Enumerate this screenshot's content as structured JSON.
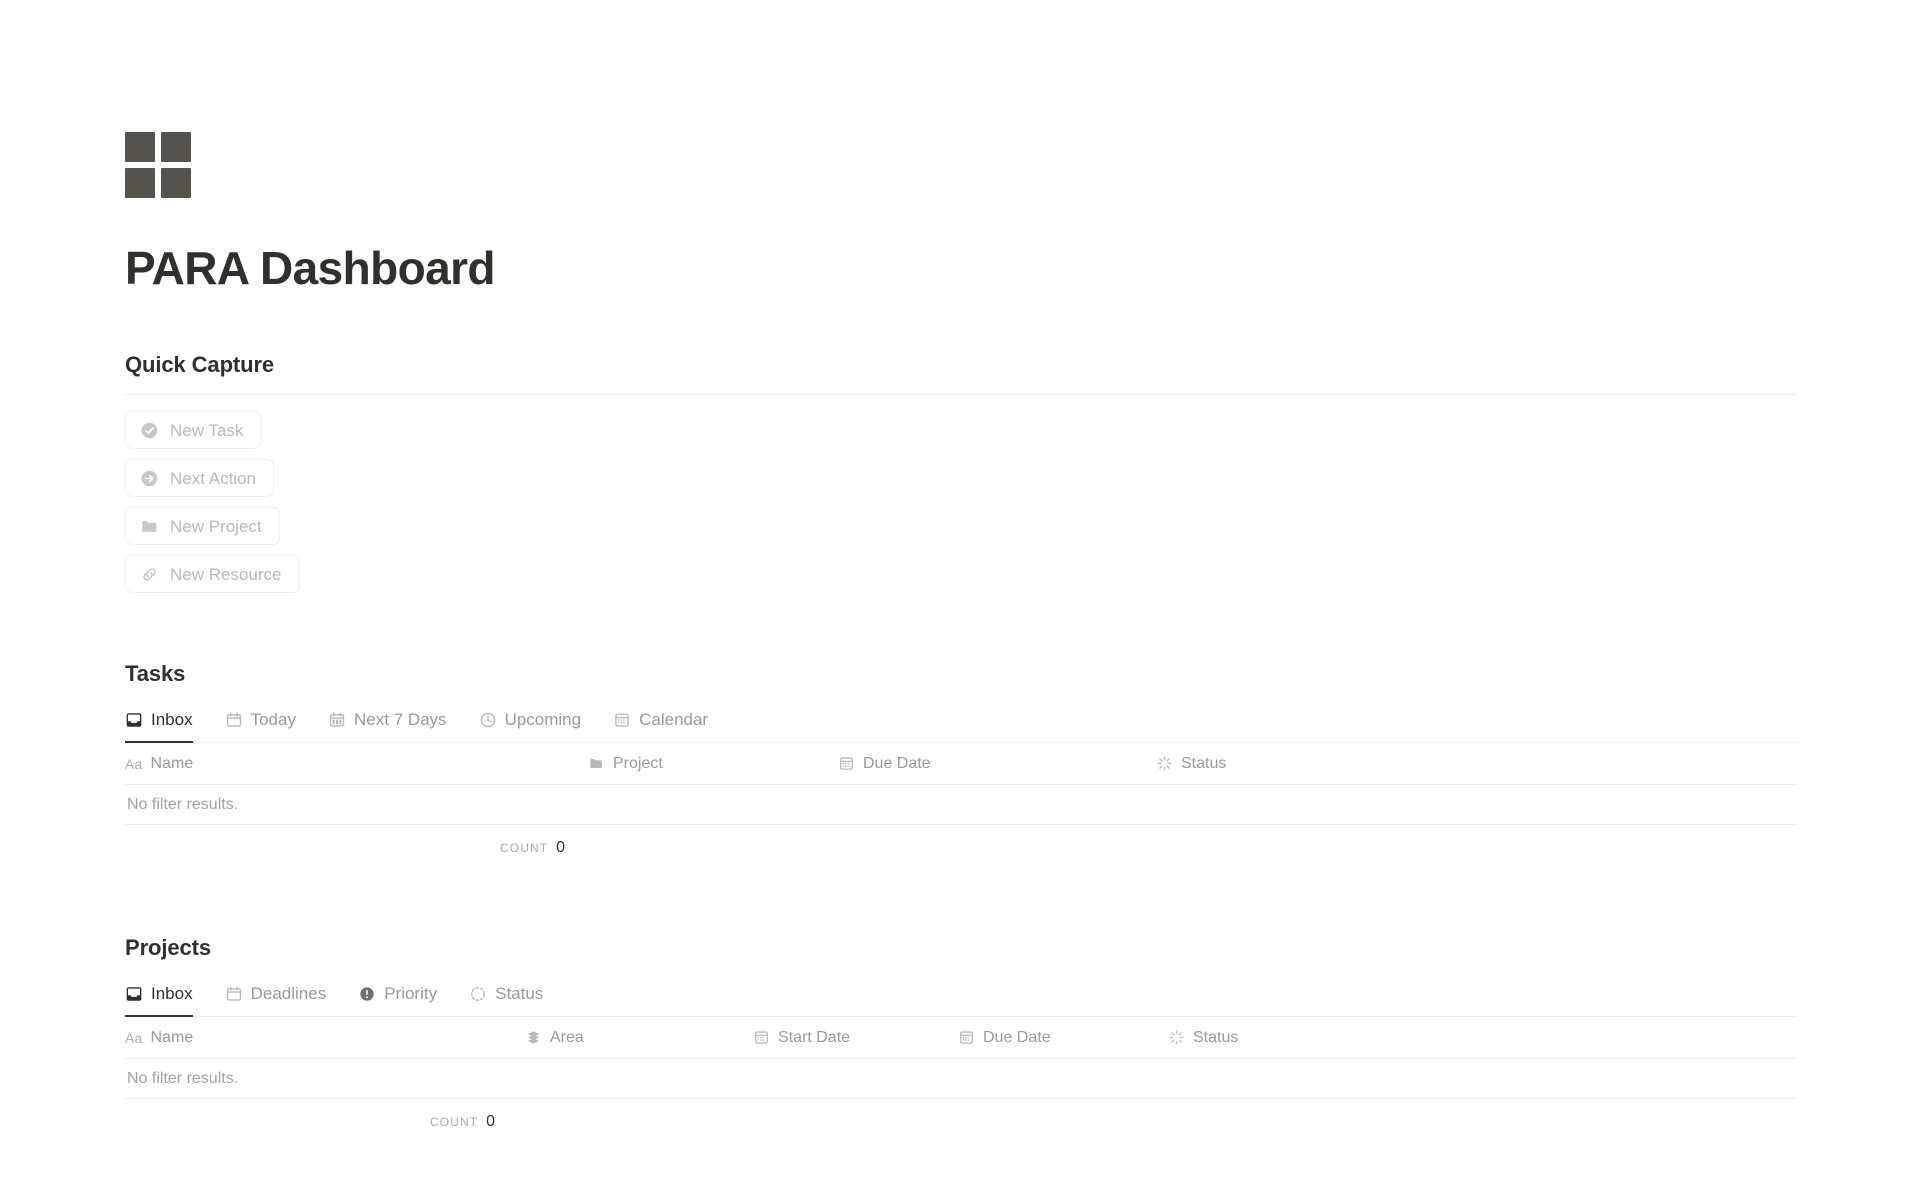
{
  "app": {
    "title": "PARA Dashboard",
    "logo_icon": "four-squares-grid-icon",
    "logo_color": "#55534e",
    "accent_color": "#32302c",
    "muted_color": "#9b9a97",
    "border_color": "#e9e9e7"
  },
  "quick_capture": {
    "heading": "Quick Capture",
    "buttons": [
      {
        "label": "New Task",
        "icon": "check-circle-icon"
      },
      {
        "label": "Next Action",
        "icon": "arrow-right-circle-icon"
      },
      {
        "label": "New Project",
        "icon": "folder-icon"
      },
      {
        "label": "New Resource",
        "icon": "link-icon"
      }
    ]
  },
  "tasks": {
    "heading": "Tasks",
    "tabs": [
      {
        "label": "Inbox",
        "icon": "inbox-icon",
        "active": true
      },
      {
        "label": "Today",
        "icon": "calendar-icon",
        "active": false
      },
      {
        "label": "Next 7 Days",
        "icon": "calendar-days-icon",
        "active": false
      },
      {
        "label": "Upcoming",
        "icon": "clock-icon",
        "active": false
      },
      {
        "label": "Calendar",
        "icon": "calendar-grid-icon",
        "active": false
      }
    ],
    "columns": [
      {
        "label": "Name",
        "icon": "text-aa-icon"
      },
      {
        "label": "Project",
        "icon": "folder-icon"
      },
      {
        "label": "Due Date",
        "icon": "calendar-grid-icon"
      },
      {
        "label": "Status",
        "icon": "spinner-icon"
      }
    ],
    "empty_message": "No filter results.",
    "count_label": "COUNT",
    "count_value": "0"
  },
  "projects": {
    "heading": "Projects",
    "tabs": [
      {
        "label": "Inbox",
        "icon": "inbox-icon",
        "active": true
      },
      {
        "label": "Deadlines",
        "icon": "calendar-icon",
        "active": false
      },
      {
        "label": "Priority",
        "icon": "alert-circle-icon",
        "active": false
      },
      {
        "label": "Status",
        "icon": "dashed-circle-icon",
        "active": false
      }
    ],
    "columns": [
      {
        "label": "Name",
        "icon": "text-aa-icon"
      },
      {
        "label": "Area",
        "icon": "layers-icon"
      },
      {
        "label": "Start Date",
        "icon": "calendar-grid-icon"
      },
      {
        "label": "Due Date",
        "icon": "calendar-grid-icon"
      },
      {
        "label": "Status",
        "icon": "spinner-icon"
      }
    ],
    "empty_message": "No filter results.",
    "count_label": "COUNT",
    "count_value": "0"
  }
}
